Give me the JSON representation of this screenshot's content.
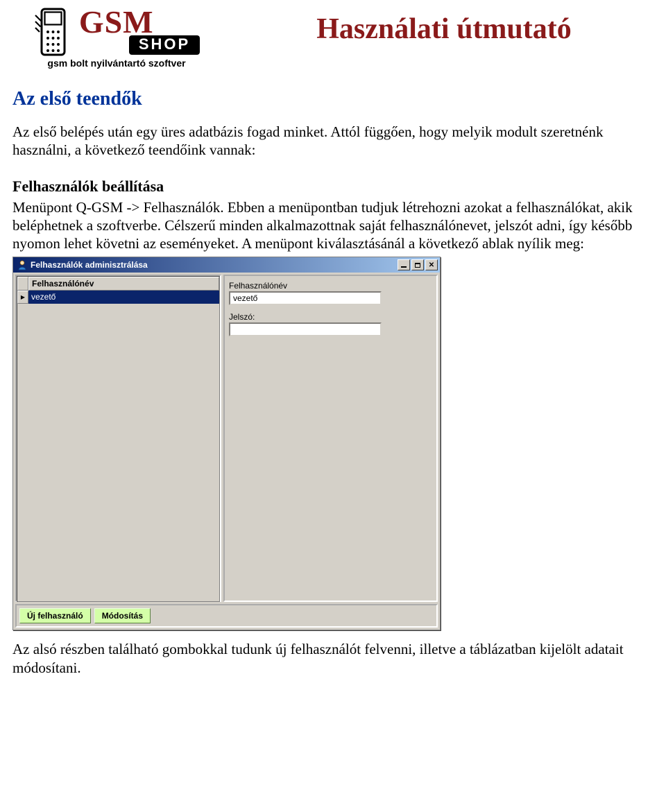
{
  "logo": {
    "brand_top": "GSM",
    "brand_box": "SHOP",
    "tagline": "gsm bolt nyilvántartó szoftver"
  },
  "main_title": "Használati útmutató",
  "section_title": "Az első teendők",
  "intro_text": "Az első belépés után egy üres adatbázis fogad minket. Attól függően, hogy melyik modult szeretnénk használni, a következő teendőink vannak:",
  "subsection_title": "Felhasználók beállítása",
  "body_text": "Menüpont Q-GSM -> Felhasználók. Ebben a menüpontban tudjuk létrehozni azokat a felhasználókat, akik beléphetnek a szoftverbe. Célszerű minden alkalmazottnak saját felhasználónevet, jelszót adni, így később nyomon lehet követni az eseményeket. A menüpont kiválasztásánál a következő ablak nyílik meg:",
  "dialog": {
    "title": "Felhasználók adminisztrálása",
    "grid_header": "Felhasználónév",
    "selected_row": "vezető",
    "right": {
      "username_label": "Felhasználónév",
      "username_value": "vezető",
      "password_label": "Jelszó:",
      "password_value": ""
    },
    "buttons": {
      "new_user": "Új felhasználó",
      "modify": "Módosítás"
    }
  },
  "footer_text": "Az alsó részben található gombokkal tudunk új felhasználót felvenni, illetve a táblázatban kijelölt adatait módosítani."
}
